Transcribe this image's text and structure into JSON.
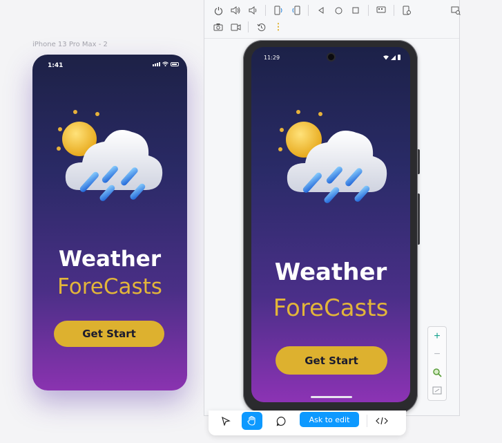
{
  "figma_frame": {
    "label": "iPhone 13 Pro Max - 2",
    "status_time": "1:41",
    "title_line1": "Weather",
    "title_line2": "ForeCasts",
    "button_label": "Get Start"
  },
  "emulator": {
    "toolbar_row1": [
      "power-icon",
      "volume-up-icon",
      "volume-down-icon",
      "rotate-left-icon",
      "rotate-right-icon",
      "back-icon",
      "home-icon",
      "overview-icon",
      "screenshot-settings-icon",
      "device-settings-icon",
      "zoom-window-icon"
    ],
    "toolbar_row2": [
      "camera-icon",
      "video-record-icon",
      "history-icon",
      "more-options-icon"
    ],
    "status_time": "11:29",
    "title_line1": "Weather",
    "title_line2": "ForeCasts",
    "button_label": "Get Start",
    "zoom_controls": [
      "zoom-in-icon",
      "zoom-out-icon",
      "zoom-fit-icon",
      "zoom-area-icon"
    ]
  },
  "bottom_toolbar": {
    "tools": [
      "pointer-icon",
      "hand-icon",
      "comment-icon",
      "code-icon"
    ],
    "active_tool": "hand-icon",
    "ask_label": "Ask to edit"
  },
  "colors": {
    "gold": "#e2b53a",
    "button": "#ddb12f",
    "accent_blue": "#0d99ff",
    "zoom_teal": "#17a28e"
  }
}
